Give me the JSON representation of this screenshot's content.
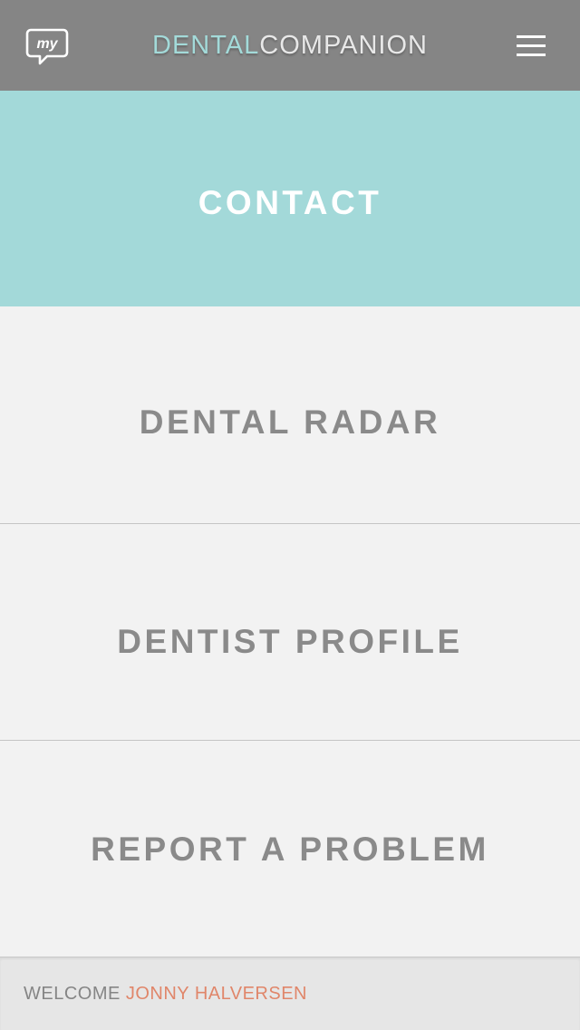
{
  "header": {
    "logo_text": "my",
    "brand_part1": "DENTAL",
    "brand_part2": "COMPANION"
  },
  "menu": {
    "items": [
      {
        "label": "CONTACT",
        "active": true
      },
      {
        "label": "DENTAL RADAR",
        "active": false
      },
      {
        "label": "DENTIST PROFILE",
        "active": false
      },
      {
        "label": "REPORT A PROBLEM",
        "active": false
      }
    ]
  },
  "footer": {
    "welcome_text": "WELCOME",
    "user_name": "JONNY HALVERSEN"
  },
  "colors": {
    "header_bg": "#858585",
    "accent_teal": "#a3d9d9",
    "menu_bg": "#f2f2f2",
    "menu_text": "#8a8a8a",
    "user_name": "#e0866a"
  }
}
